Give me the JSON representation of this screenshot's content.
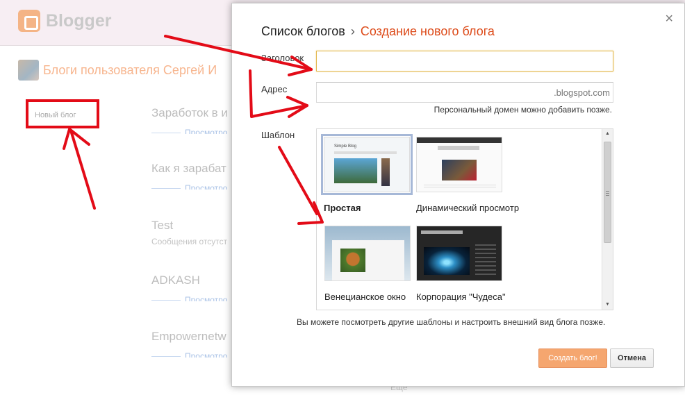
{
  "app": {
    "name": "Blogger"
  },
  "dashboard": {
    "user_title": "Блоги пользователя Сергей И",
    "new_blog_label": "Новый блог",
    "blogs": [
      {
        "name": "Заработок в и",
        "views": "Просмотро"
      },
      {
        "name": "Как я зарабат",
        "views": "Просмотро"
      },
      {
        "name": "Test",
        "sub": "Сообщения отсутст"
      },
      {
        "name": "ADKASH",
        "views": "Просмотро"
      },
      {
        "name": "Empowernetw",
        "views": "Просмотро"
      }
    ],
    "more_label": "Ещё"
  },
  "dialog": {
    "breadcrumb_root": "Список блогов",
    "breadcrumb_sep": "›",
    "breadcrumb_current": "Создание нового блога",
    "close_glyph": "×",
    "title_label": "Заголовок",
    "title_value": "",
    "address_label": "Адрес",
    "address_value": "",
    "address_suffix": ".blogspot.com",
    "domain_hint": "Персональный домен можно добавить позже.",
    "template_label": "Шаблон",
    "templates": [
      {
        "name": "Простая",
        "selected": true,
        "thumb_text": "Simple Blog"
      },
      {
        "name": "Динамический просмотр",
        "selected": false
      },
      {
        "name": "Венецианское окно",
        "selected": false
      },
      {
        "name": "Корпорация \"Чудеса\"",
        "selected": false
      }
    ],
    "templates_hint": "Вы можете посмотреть другие шаблоны и настроить внешний вид блога позже.",
    "create_button": "Создать блог!",
    "cancel_button": "Отмена"
  },
  "colors": {
    "accent": "#dd4b1a",
    "create_button": "#f5a66f",
    "annotation": "#e30b17"
  }
}
